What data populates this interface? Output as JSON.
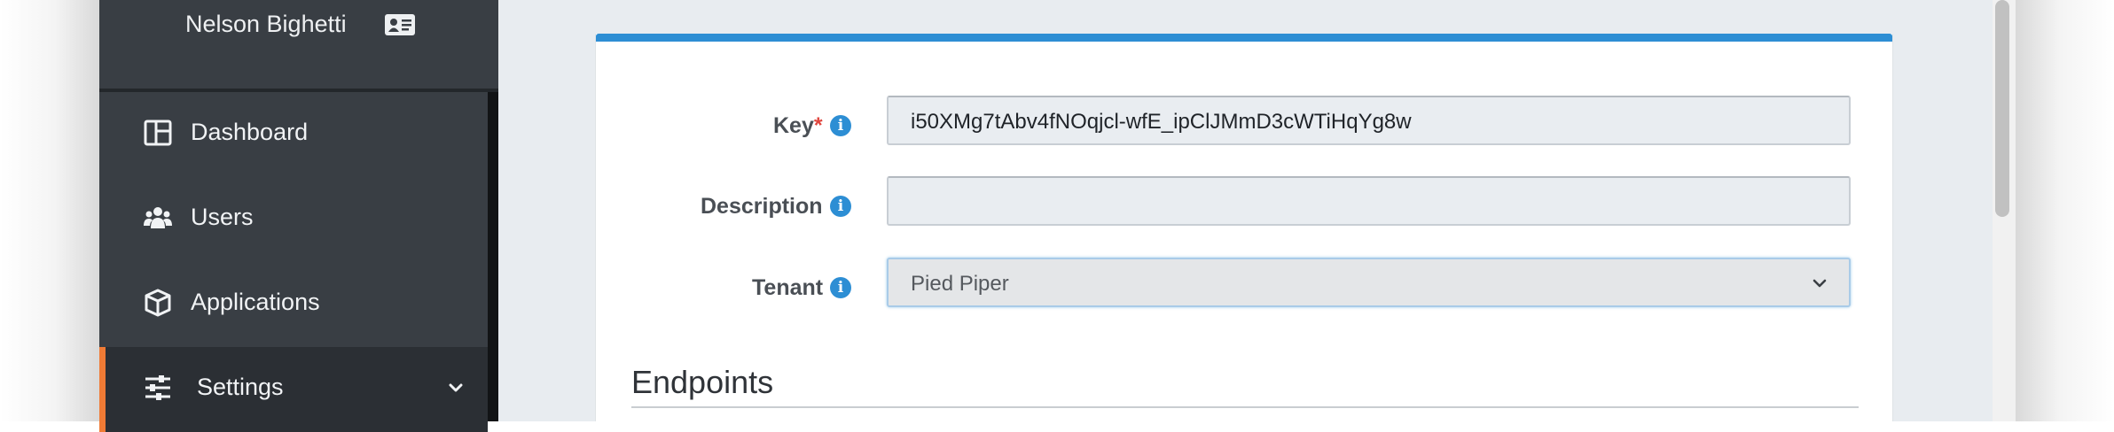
{
  "sidebar": {
    "user_name": "Nelson Bighetti",
    "items": [
      {
        "label": "Dashboard",
        "icon": "dashboard-icon"
      },
      {
        "label": "Users",
        "icon": "users-icon"
      },
      {
        "label": "Applications",
        "icon": "cube-icon"
      },
      {
        "label": "Settings",
        "icon": "sliders-icon",
        "active": true
      }
    ]
  },
  "form": {
    "key": {
      "label": "Key",
      "required_mark": "*",
      "value": "i50XMg7tAbv4fNOqjcl-wfE_ipClJMmD3cWTiHqYg8w"
    },
    "description": {
      "label": "Description",
      "value": ""
    },
    "tenant": {
      "label": "Tenant",
      "value": "Pied Piper"
    },
    "info_glyph": "i"
  },
  "section": {
    "title": "Endpoints"
  },
  "colors": {
    "accent": "#2d8ed4",
    "active_nav": "#f07b35",
    "required": "#e0463e",
    "sidebar_bg": "#393e44"
  }
}
